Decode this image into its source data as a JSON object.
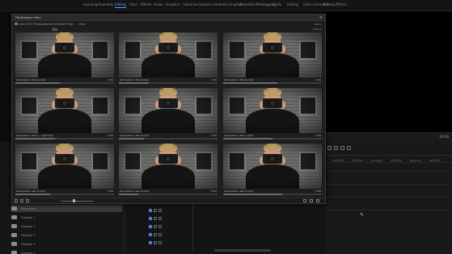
{
  "menubar": {
    "items": [
      "Learning",
      "Assembly",
      "Editing",
      "Color",
      "Effects",
      "Audio",
      "Graphics",
      "Libraries",
      "Captions",
      "Essential Graphics",
      "Assembly",
      "Metalogging",
      "Audio",
      "Editing",
      "Color Correction",
      "Editing Effects"
    ],
    "active_index": 2
  },
  "browser": {
    "title": "File Browser: Hero",
    "path": "Color Film Photographer-Selected Clips - ...mp4",
    "subpath": "Bin",
    "sort_label": "Name",
    "count_label": "9 Items",
    "clips": [
      {
        "name": "Atmospheric Pan-R.mp4",
        "duration": "4:09",
        "progress": 0.45
      },
      {
        "name": "Atmospheric Pan-R.mp4",
        "duration": "4:09",
        "progress": 0.3
      },
      {
        "name": "Atmospheric Pan-R.mp4",
        "duration": "4:09",
        "progress": 0.55
      },
      {
        "name": "Atmospheric Pan-L - right.mp4",
        "duration": "4:09",
        "progress": 0.4
      },
      {
        "name": "Atmospheric Pan-R.mp4",
        "duration": "4:09",
        "progress": 0.25
      },
      {
        "name": "Atmospheric Pan-L.mp4",
        "duration": "4:09",
        "progress": 0.5
      },
      {
        "name": "Atmospheric Pan-R.mp4",
        "duration": "4:09",
        "progress": 0.35
      },
      {
        "name": "Atmospheric Pan-R.mp4",
        "duration": "4:09",
        "progress": 0.2
      },
      {
        "name": "Atmospheric Pan-R.mp4",
        "duration": "4:09",
        "progress": 0.6
      }
    ]
  },
  "project": {
    "bins": [
      {
        "label": "Sequences",
        "selected": true
      },
      {
        "label": "Footage 1",
        "selected": false
      },
      {
        "label": "Footage 2",
        "selected": false
      },
      {
        "label": "Footage 3",
        "selected": false
      },
      {
        "label": "Footage 4",
        "selected": false
      },
      {
        "label": "Footage 5",
        "selected": false
      }
    ],
    "side_labels": [
      "Proj",
      "Med",
      "Info"
    ]
  },
  "right_monitor": {
    "timecode": "00:00"
  },
  "timeline": {
    "ticks": [
      "00:00:00",
      "00:00:10",
      "00:00:20",
      "00:00:30",
      "00:00:40",
      "00:00:50"
    ]
  },
  "colors": {
    "accent": "#5fa8ff",
    "panel": "#1e1e1e"
  }
}
